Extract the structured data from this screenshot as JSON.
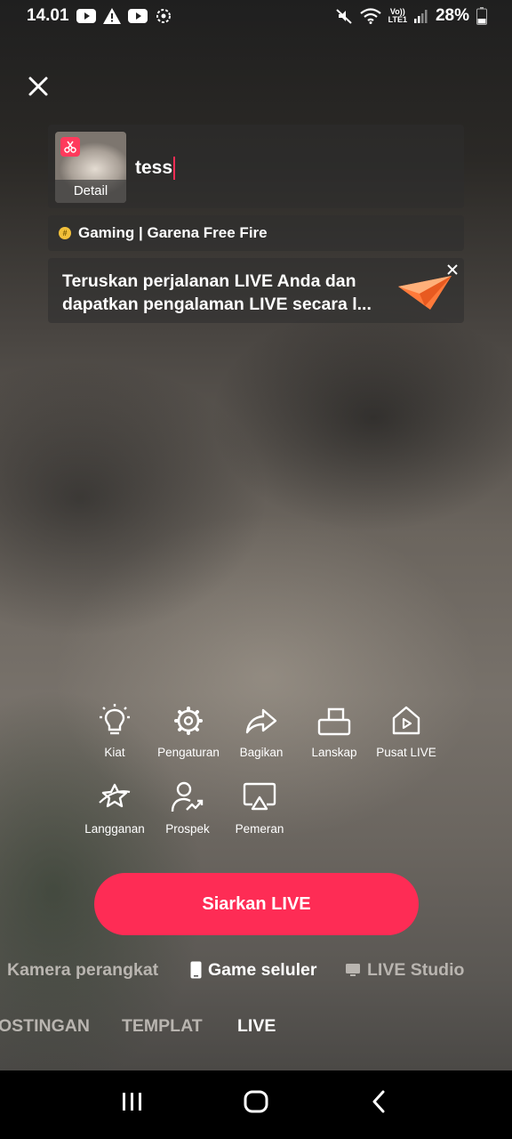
{
  "status_bar": {
    "time": "14.01",
    "battery": "28%",
    "network_label_top": "Vo))",
    "network_label_bottom": "LTE1",
    "left_icons": [
      "youtube-icon",
      "warning-icon",
      "youtube-icon",
      "settings-sync-icon"
    ],
    "right_icons": [
      "mute-icon",
      "wifi-icon",
      "signal-icon",
      "battery-icon"
    ]
  },
  "header": {
    "close_icon": "close-icon"
  },
  "title_card": {
    "thumbnail_label": "Detail",
    "title_value": "tess"
  },
  "category": {
    "label": "Gaming | Garena Free Fire"
  },
  "promo": {
    "text": "Teruskan perjalanan LIVE Anda dan dapatkan pengalaman LIVE secara l...",
    "icon": "paper-plane-icon"
  },
  "tools": [
    {
      "label": "Kiat",
      "icon": "lightbulb-icon"
    },
    {
      "label": "Pengaturan",
      "icon": "gear-icon"
    },
    {
      "label": "Bagikan",
      "icon": "share-icon"
    },
    {
      "label": "Lanskap",
      "icon": "landscape-icon"
    },
    {
      "label": "Pusat LIVE",
      "icon": "live-center-icon"
    },
    {
      "label": "Langganan",
      "icon": "subscription-icon"
    },
    {
      "label": "Prospek",
      "icon": "prospect-icon"
    },
    {
      "label": "Pemeran",
      "icon": "cast-icon"
    }
  ],
  "go_live_button": "Siarkan LIVE",
  "sources": [
    {
      "label": "Kamera perangkat",
      "active": false
    },
    {
      "label": "Game seluler",
      "active": true
    },
    {
      "label": "LIVE Studio",
      "active": false
    }
  ],
  "modes": [
    {
      "label": "OSTINGAN",
      "active": false
    },
    {
      "label": "TEMPLAT",
      "active": false
    },
    {
      "label": "LIVE",
      "active": true
    }
  ],
  "colors": {
    "accent": "#fe2c55",
    "inactive_text": "#b9b5b0"
  }
}
